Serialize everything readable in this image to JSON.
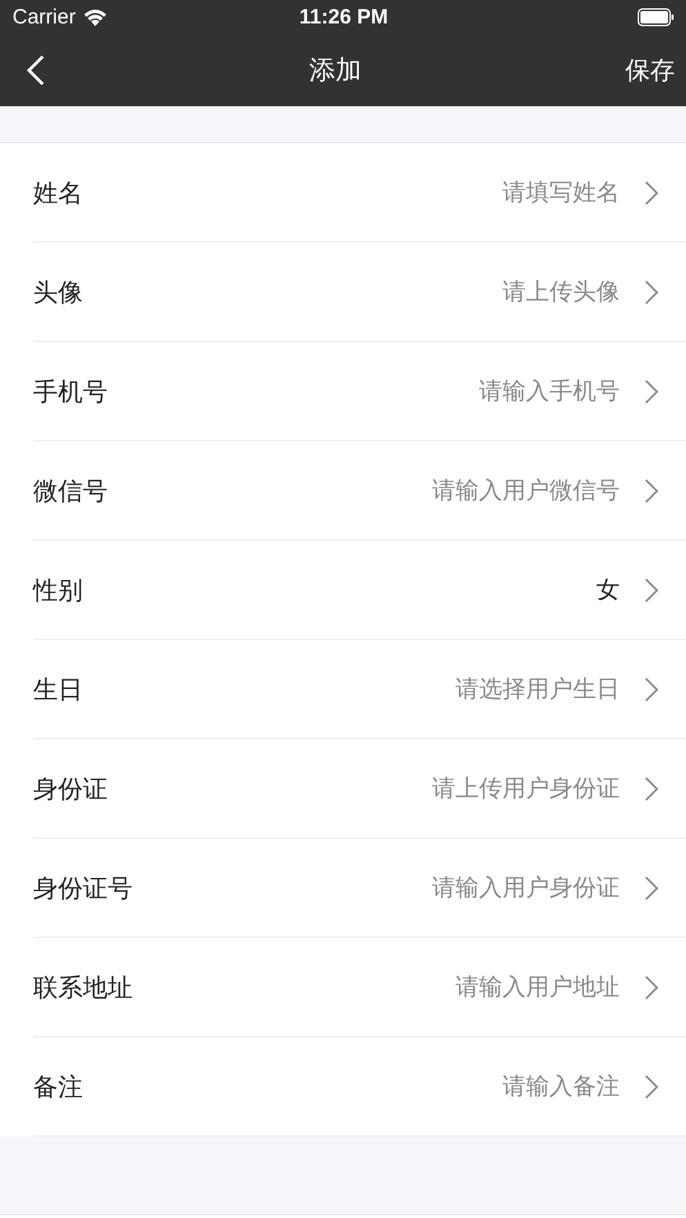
{
  "status_bar": {
    "carrier": "Carrier",
    "time": "11:26 PM"
  },
  "nav_bar": {
    "title": "添加",
    "action": "保存"
  },
  "fields": [
    {
      "label": "姓名",
      "placeholder": "请填写姓名"
    },
    {
      "label": "头像",
      "placeholder": "请上传头像"
    },
    {
      "label": "手机号",
      "placeholder": "请输入手机号"
    },
    {
      "label": "微信号",
      "placeholder": "请输入用户微信号"
    },
    {
      "label": "性别",
      "value": "女"
    },
    {
      "label": "生日",
      "placeholder": "请选择用户生日"
    },
    {
      "label": "身份证",
      "placeholder": "请上传用户身份证"
    },
    {
      "label": "身份证号",
      "placeholder": "请输入用户身份证"
    },
    {
      "label": "联系地址",
      "placeholder": "请输入用户地址"
    },
    {
      "label": "备注",
      "placeholder": "请输入备注"
    }
  ]
}
